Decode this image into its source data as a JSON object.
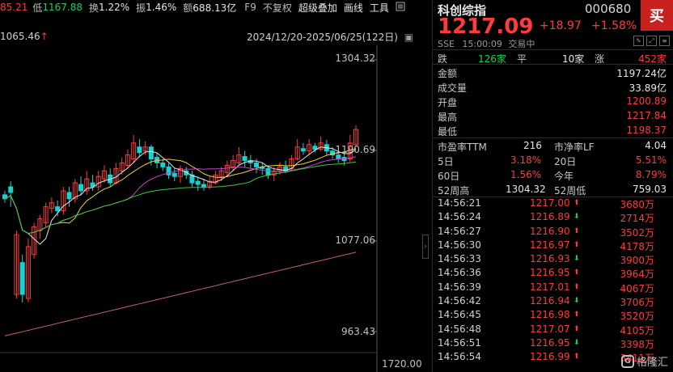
{
  "info_bar": {
    "first": "85.21",
    "low_label": "低",
    "low_value": "1167.88",
    "turnover_label": "换",
    "turnover_value": "1.22%",
    "amplitude_label": "振",
    "amplitude_value": "1.46%",
    "amount_label": "额",
    "amount_value": "688.13亿",
    "f9": "F9",
    "no_adjust": "不复权",
    "overlay": "超级叠加",
    "draw": "画线",
    "tools": "工具",
    "menu_icon": "menu-icon"
  },
  "chart": {
    "high_marker": "1065.46",
    "range": "2024/12/20-2025/06/25(122日)",
    "price_labels": [
      "1304.32",
      "1190.69",
      "1077.06",
      "963.43"
    ],
    "volume_label": "1720.00亿",
    "colors": {
      "up": "#ff3b3b",
      "down": "#19d1d1",
      "ma5": "#e6e6e6",
      "ma10": "#f0d23c",
      "ma20": "#d040d0",
      "ma60": "#3cc83c",
      "ma250": "#c86464"
    }
  },
  "quote": {
    "name": "科创综指",
    "code": "000680",
    "buy_label": "买",
    "price": "1217.09",
    "change": "+18.97",
    "change_pct": "+1.58%",
    "exchange": "SSE",
    "time": "15:00:09",
    "status": "交易中",
    "advance": {
      "fall_label": "跌",
      "fall_value": "126家",
      "flat_label": "平",
      "flat_value": "10家",
      "rise_label": "涨",
      "rise_value": "452家"
    },
    "stats": [
      {
        "label": "金额",
        "value": "1197.24亿",
        "color": "#e6e6e6"
      },
      {
        "label": "成交量",
        "value": "33.89亿",
        "color": "#e6e6e6"
      },
      {
        "label": "开盘",
        "value": "1200.89",
        "color": "#ff3b3b"
      },
      {
        "label": "最高",
        "value": "1217.84",
        "color": "#ff3b3b"
      },
      {
        "label": "最低",
        "value": "1198.37",
        "color": "#ff3b3b"
      }
    ],
    "valuation": {
      "pe_label": "市盈率TTM",
      "pe_value": "216",
      "pb_label": "市净率LF",
      "pb_value": "4.04",
      "d5_label": "5日",
      "d5_value": "3.18%",
      "d20_label": "20日",
      "d20_value": "5.51%",
      "d60_label": "60日",
      "d60_value": "1.56%",
      "ytd_label": "今年",
      "ytd_value": "8.79%",
      "h52_label": "52周高",
      "h52_value": "1304.32",
      "l52_label": "52周低",
      "l52_value": "759.03"
    },
    "ticks": [
      {
        "time": "14:56:21",
        "price": "1217.00",
        "dir": "up",
        "vol": "3680万"
      },
      {
        "time": "14:56:24",
        "price": "1216.89",
        "dir": "down",
        "vol": "2714万"
      },
      {
        "time": "14:56:27",
        "price": "1216.90",
        "dir": "up",
        "vol": "3502万"
      },
      {
        "time": "14:56:30",
        "price": "1216.97",
        "dir": "up",
        "vol": "4178万"
      },
      {
        "time": "14:56:33",
        "price": "1216.93",
        "dir": "down",
        "vol": "3900万"
      },
      {
        "time": "14:56:36",
        "price": "1216.95",
        "dir": "up",
        "vol": "3964万"
      },
      {
        "time": "14:56:39",
        "price": "1217.01",
        "dir": "up",
        "vol": "4067万"
      },
      {
        "time": "14:56:42",
        "price": "1216.94",
        "dir": "down",
        "vol": "3706万"
      },
      {
        "time": "14:56:45",
        "price": "1216.98",
        "dir": "up",
        "vol": "3520万"
      },
      {
        "time": "14:56:48",
        "price": "1217.07",
        "dir": "up",
        "vol": "4105万"
      },
      {
        "time": "14:56:51",
        "price": "1216.95",
        "dir": "down",
        "vol": "3398万"
      },
      {
        "time": "14:56:54",
        "price": "1216.99",
        "dir": "up",
        "vol": "3411万"
      }
    ],
    "watermark": "格隆汇",
    "watermark_logo": "G"
  }
}
